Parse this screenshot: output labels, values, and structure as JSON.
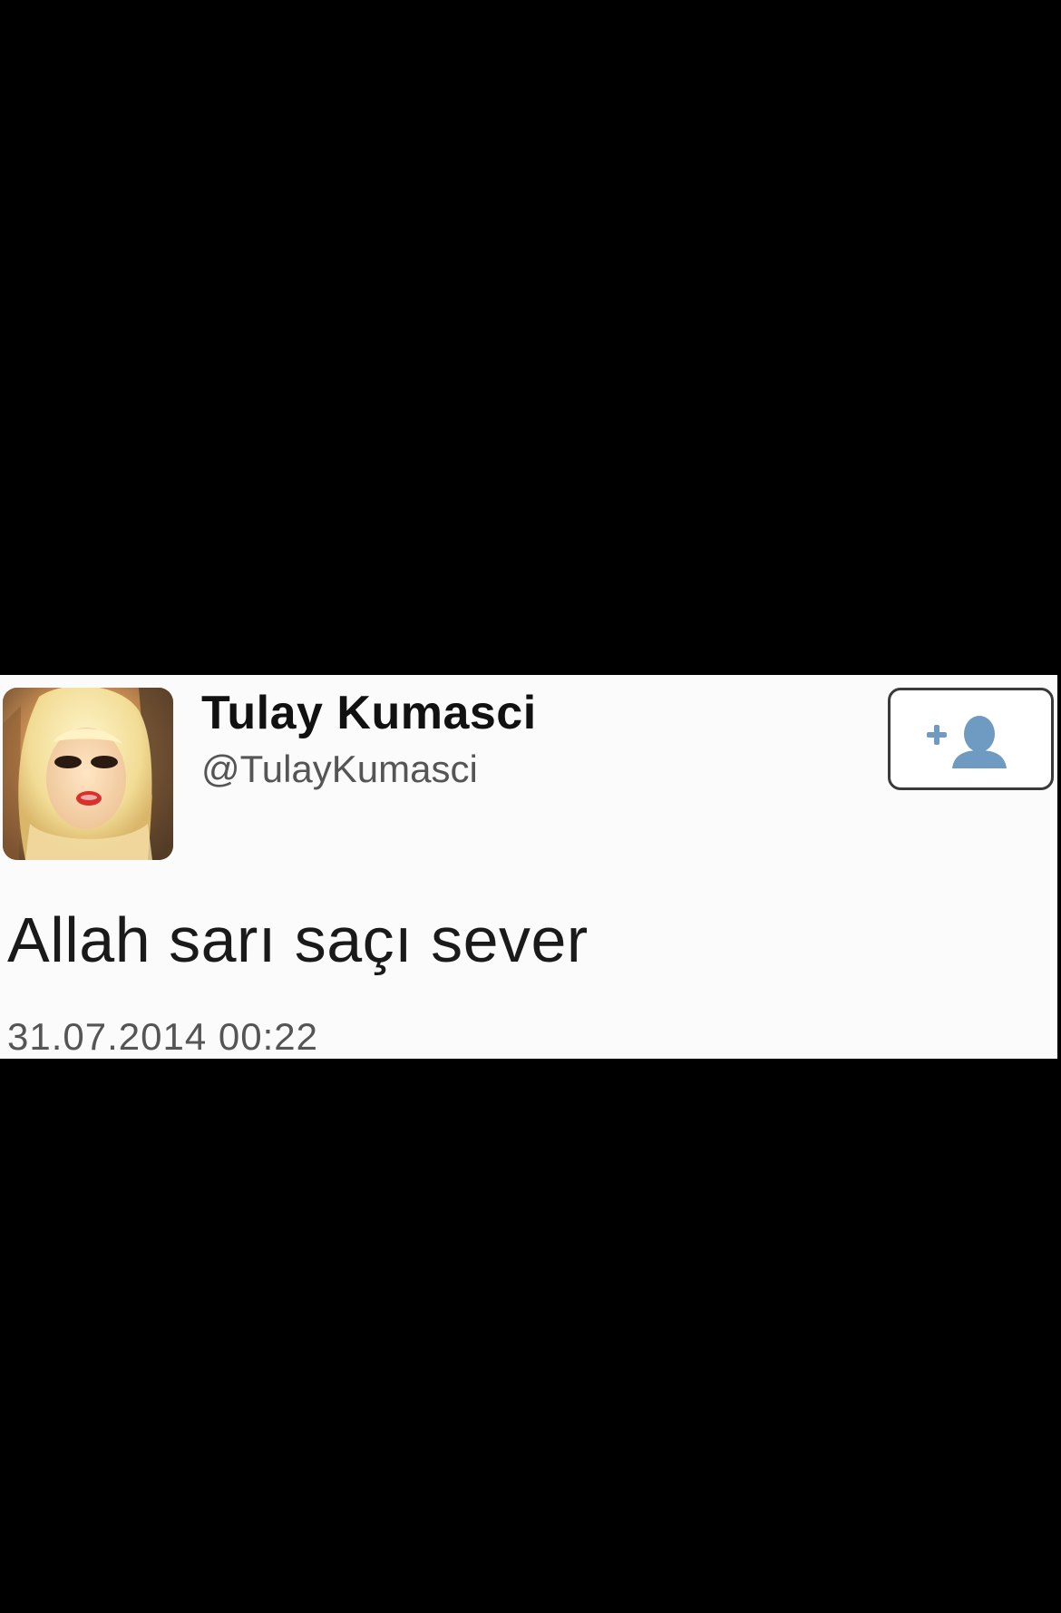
{
  "tweet": {
    "display_name": "Tulay Kumasci",
    "handle": "@TulayKumasci",
    "text": "Allah sarı saçı sever",
    "timestamp": "31.07.2014 00:22",
    "avatar_icon": "profile-photo-avatar",
    "follow_icon": "add-user-icon"
  },
  "colors": {
    "background": "#000000",
    "card": "#fbfbfb",
    "follow_icon": "#6f9ac2"
  }
}
